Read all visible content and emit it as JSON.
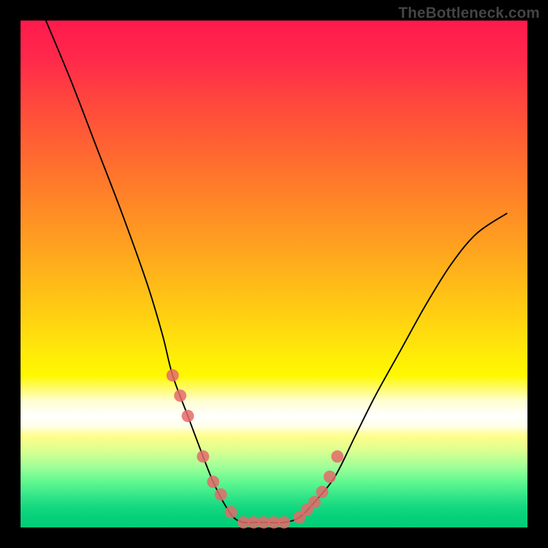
{
  "watermark": "TheBottleneck.com",
  "chart_data": {
    "type": "line",
    "title": "",
    "xlabel": "",
    "ylabel": "",
    "xlim": [
      0,
      100
    ],
    "ylim": [
      0,
      100
    ],
    "grid": false,
    "legend": false,
    "series": [
      {
        "name": "bottleneck-curve",
        "x": [
          5,
          10,
          15,
          20,
          25,
          28,
          30,
          33,
          36,
          38,
          40,
          42,
          44,
          46,
          48,
          52,
          55,
          58,
          62,
          66,
          70,
          75,
          80,
          85,
          90,
          96
        ],
        "y": [
          100,
          88,
          75,
          62,
          48,
          38,
          30,
          22,
          14,
          9,
          5,
          2,
          1,
          1,
          1,
          1,
          2,
          5,
          10,
          18,
          26,
          35,
          44,
          52,
          58,
          62
        ]
      }
    ],
    "markers": {
      "name": "highlight-dots",
      "color": "#e46a6a",
      "x": [
        30.0,
        31.5,
        33.0,
        36.0,
        38.0,
        39.5,
        41.5,
        44.0,
        46.0,
        48.0,
        50.0,
        52.0,
        55.0,
        56.5,
        58.0,
        59.5,
        61.0,
        62.5
      ],
      "y": [
        30.0,
        26.0,
        22.0,
        14.0,
        9.0,
        6.5,
        3.0,
        1.0,
        1.0,
        1.0,
        1.0,
        1.0,
        2.0,
        3.5,
        5.0,
        7.0,
        10.0,
        14.0
      ]
    },
    "background_gradient": {
      "top": "#ff1a4d",
      "upper_mid": "#ffe80a",
      "lower_mid": "#ffffff",
      "bottom": "#02cc78"
    }
  }
}
